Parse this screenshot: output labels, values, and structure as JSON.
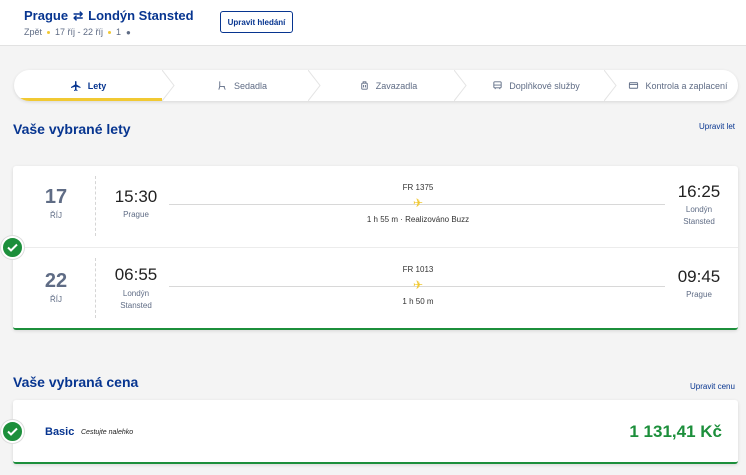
{
  "header": {
    "origin": "Prague",
    "destination": "Londýn Stansted",
    "trip_type": "Zpět",
    "dates": "17 říj - 22 říj",
    "passengers": "1",
    "modify_label": "Upravit hledání"
  },
  "steps": [
    {
      "label": "Lety",
      "icon": "plane-icon",
      "active": true
    },
    {
      "label": "Sedadla",
      "icon": "seat-icon",
      "active": false
    },
    {
      "label": "Zavazadla",
      "icon": "luggage-icon",
      "active": false
    },
    {
      "label": "Doplňkové služby",
      "icon": "bus-icon",
      "active": false
    },
    {
      "label": "Kontrola a zaplacení",
      "icon": "card-icon",
      "active": false
    }
  ],
  "flights_section": {
    "title": "Vaše vybrané lety",
    "edit_label": "Upravit let"
  },
  "flights": [
    {
      "day": "17",
      "month": "ŘÍJ",
      "dep_time": "15:30",
      "dep_city": "Prague",
      "flight_no": "FR 1375",
      "duration": "1 h 55 m · Realizováno Buzz",
      "arr_time": "16:25",
      "arr_city_1": "Londýn",
      "arr_city_2": "Stansted"
    },
    {
      "day": "22",
      "month": "ŘÍJ",
      "dep_time": "06:55",
      "dep_city_1": "Londýn",
      "dep_city_2": "Stansted",
      "flight_no": "FR 1013",
      "duration": "1 h 50 m",
      "arr_time": "09:45",
      "arr_city": "Prague"
    }
  ],
  "price_section": {
    "title": "Vaše vybraná cena",
    "edit_label": "Upravit cenu",
    "fare_name": "Basic",
    "fare_tagline": "Cestujte nalehko",
    "price": "1 131,41 Kč"
  },
  "colors": {
    "brand": "#073590",
    "accent": "#f1c933",
    "success": "#1c8f3b"
  }
}
